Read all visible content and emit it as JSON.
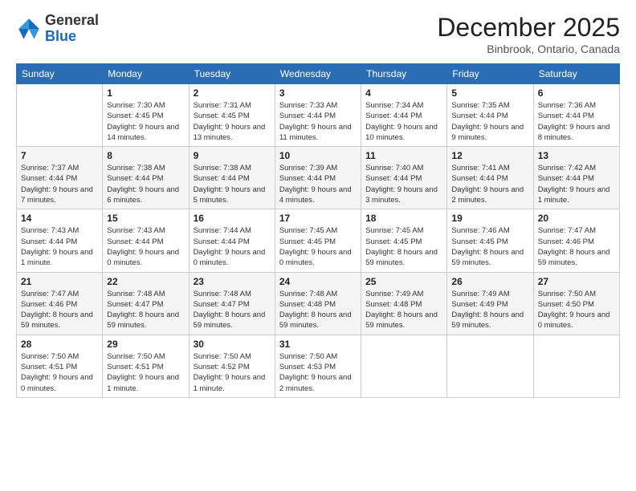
{
  "header": {
    "logo_line1": "General",
    "logo_line2": "Blue",
    "month": "December 2025",
    "location": "Binbrook, Ontario, Canada"
  },
  "weekdays": [
    "Sunday",
    "Monday",
    "Tuesday",
    "Wednesday",
    "Thursday",
    "Friday",
    "Saturday"
  ],
  "weeks": [
    [
      {
        "day": "",
        "sunrise": "",
        "sunset": "",
        "daylight": ""
      },
      {
        "day": "1",
        "sunrise": "Sunrise: 7:30 AM",
        "sunset": "Sunset: 4:45 PM",
        "daylight": "Daylight: 9 hours and 14 minutes."
      },
      {
        "day": "2",
        "sunrise": "Sunrise: 7:31 AM",
        "sunset": "Sunset: 4:45 PM",
        "daylight": "Daylight: 9 hours and 13 minutes."
      },
      {
        "day": "3",
        "sunrise": "Sunrise: 7:33 AM",
        "sunset": "Sunset: 4:44 PM",
        "daylight": "Daylight: 9 hours and 11 minutes."
      },
      {
        "day": "4",
        "sunrise": "Sunrise: 7:34 AM",
        "sunset": "Sunset: 4:44 PM",
        "daylight": "Daylight: 9 hours and 10 minutes."
      },
      {
        "day": "5",
        "sunrise": "Sunrise: 7:35 AM",
        "sunset": "Sunset: 4:44 PM",
        "daylight": "Daylight: 9 hours and 9 minutes."
      },
      {
        "day": "6",
        "sunrise": "Sunrise: 7:36 AM",
        "sunset": "Sunset: 4:44 PM",
        "daylight": "Daylight: 9 hours and 8 minutes."
      }
    ],
    [
      {
        "day": "7",
        "sunrise": "Sunrise: 7:37 AM",
        "sunset": "Sunset: 4:44 PM",
        "daylight": "Daylight: 9 hours and 7 minutes."
      },
      {
        "day": "8",
        "sunrise": "Sunrise: 7:38 AM",
        "sunset": "Sunset: 4:44 PM",
        "daylight": "Daylight: 9 hours and 6 minutes."
      },
      {
        "day": "9",
        "sunrise": "Sunrise: 7:38 AM",
        "sunset": "Sunset: 4:44 PM",
        "daylight": "Daylight: 9 hours and 5 minutes."
      },
      {
        "day": "10",
        "sunrise": "Sunrise: 7:39 AM",
        "sunset": "Sunset: 4:44 PM",
        "daylight": "Daylight: 9 hours and 4 minutes."
      },
      {
        "day": "11",
        "sunrise": "Sunrise: 7:40 AM",
        "sunset": "Sunset: 4:44 PM",
        "daylight": "Daylight: 9 hours and 3 minutes."
      },
      {
        "day": "12",
        "sunrise": "Sunrise: 7:41 AM",
        "sunset": "Sunset: 4:44 PM",
        "daylight": "Daylight: 9 hours and 2 minutes."
      },
      {
        "day": "13",
        "sunrise": "Sunrise: 7:42 AM",
        "sunset": "Sunset: 4:44 PM",
        "daylight": "Daylight: 9 hours and 1 minute."
      }
    ],
    [
      {
        "day": "14",
        "sunrise": "Sunrise: 7:43 AM",
        "sunset": "Sunset: 4:44 PM",
        "daylight": "Daylight: 9 hours and 1 minute."
      },
      {
        "day": "15",
        "sunrise": "Sunrise: 7:43 AM",
        "sunset": "Sunset: 4:44 PM",
        "daylight": "Daylight: 9 hours and 0 minutes."
      },
      {
        "day": "16",
        "sunrise": "Sunrise: 7:44 AM",
        "sunset": "Sunset: 4:44 PM",
        "daylight": "Daylight: 9 hours and 0 minutes."
      },
      {
        "day": "17",
        "sunrise": "Sunrise: 7:45 AM",
        "sunset": "Sunset: 4:45 PM",
        "daylight": "Daylight: 9 hours and 0 minutes."
      },
      {
        "day": "18",
        "sunrise": "Sunrise: 7:45 AM",
        "sunset": "Sunset: 4:45 PM",
        "daylight": "Daylight: 8 hours and 59 minutes."
      },
      {
        "day": "19",
        "sunrise": "Sunrise: 7:46 AM",
        "sunset": "Sunset: 4:45 PM",
        "daylight": "Daylight: 8 hours and 59 minutes."
      },
      {
        "day": "20",
        "sunrise": "Sunrise: 7:47 AM",
        "sunset": "Sunset: 4:46 PM",
        "daylight": "Daylight: 8 hours and 59 minutes."
      }
    ],
    [
      {
        "day": "21",
        "sunrise": "Sunrise: 7:47 AM",
        "sunset": "Sunset: 4:46 PM",
        "daylight": "Daylight: 8 hours and 59 minutes."
      },
      {
        "day": "22",
        "sunrise": "Sunrise: 7:48 AM",
        "sunset": "Sunset: 4:47 PM",
        "daylight": "Daylight: 8 hours and 59 minutes."
      },
      {
        "day": "23",
        "sunrise": "Sunrise: 7:48 AM",
        "sunset": "Sunset: 4:47 PM",
        "daylight": "Daylight: 8 hours and 59 minutes."
      },
      {
        "day": "24",
        "sunrise": "Sunrise: 7:48 AM",
        "sunset": "Sunset: 4:48 PM",
        "daylight": "Daylight: 8 hours and 59 minutes."
      },
      {
        "day": "25",
        "sunrise": "Sunrise: 7:49 AM",
        "sunset": "Sunset: 4:48 PM",
        "daylight": "Daylight: 8 hours and 59 minutes."
      },
      {
        "day": "26",
        "sunrise": "Sunrise: 7:49 AM",
        "sunset": "Sunset: 4:49 PM",
        "daylight": "Daylight: 8 hours and 59 minutes."
      },
      {
        "day": "27",
        "sunrise": "Sunrise: 7:50 AM",
        "sunset": "Sunset: 4:50 PM",
        "daylight": "Daylight: 9 hours and 0 minutes."
      }
    ],
    [
      {
        "day": "28",
        "sunrise": "Sunrise: 7:50 AM",
        "sunset": "Sunset: 4:51 PM",
        "daylight": "Daylight: 9 hours and 0 minutes."
      },
      {
        "day": "29",
        "sunrise": "Sunrise: 7:50 AM",
        "sunset": "Sunset: 4:51 PM",
        "daylight": "Daylight: 9 hours and 1 minute."
      },
      {
        "day": "30",
        "sunrise": "Sunrise: 7:50 AM",
        "sunset": "Sunset: 4:52 PM",
        "daylight": "Daylight: 9 hours and 1 minute."
      },
      {
        "day": "31",
        "sunrise": "Sunrise: 7:50 AM",
        "sunset": "Sunset: 4:53 PM",
        "daylight": "Daylight: 9 hours and 2 minutes."
      },
      {
        "day": "",
        "sunrise": "",
        "sunset": "",
        "daylight": ""
      },
      {
        "day": "",
        "sunrise": "",
        "sunset": "",
        "daylight": ""
      },
      {
        "day": "",
        "sunrise": "",
        "sunset": "",
        "daylight": ""
      }
    ]
  ]
}
